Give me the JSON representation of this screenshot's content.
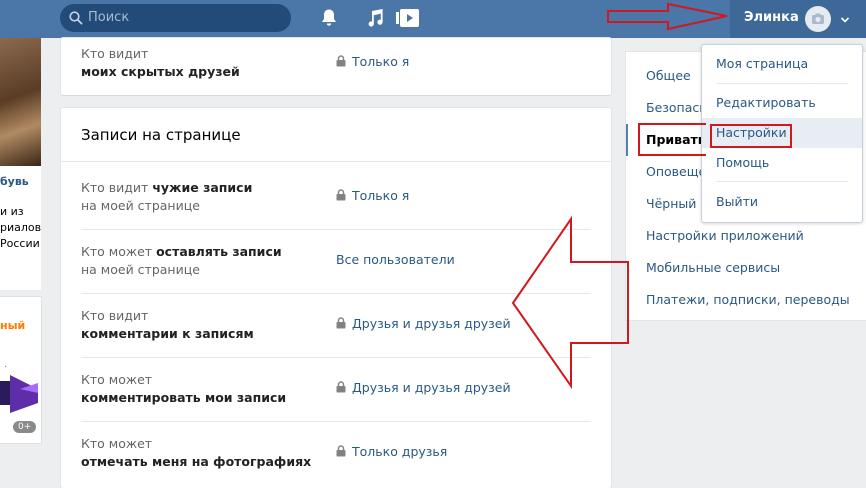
{
  "header": {
    "search_placeholder": "Поиск",
    "user_name": "Элинка"
  },
  "left": {
    "link_text": "бувь",
    "text_lines": [
      "и из",
      "риалов",
      "России"
    ],
    "ad_label": "ный",
    "ad_badge": "0+"
  },
  "card1": {
    "row": {
      "label_plain": "Кто видит",
      "label_bold": "моих скрытых друзей",
      "value": "Только я",
      "locked": true
    }
  },
  "card2": {
    "title": "Записи на странице",
    "rows": [
      {
        "label_plain": "Кто видит",
        "label_bold": "чужие записи",
        "label_plain2": "на моей странице",
        "value": "Только я",
        "locked": true
      },
      {
        "label_plain": "Кто может",
        "label_bold": "оставлять записи",
        "label_plain2": "на моей странице",
        "value": "Все пользователи",
        "locked": false
      },
      {
        "label_plain": "Кто видит",
        "label_bold": "комментарии к записям",
        "value": "Друзья и друзья друзей",
        "locked": true
      },
      {
        "label_plain": "Кто может",
        "label_bold": "комментировать мои записи",
        "value": "Друзья и друзья друзей",
        "locked": true
      },
      {
        "label_plain": "Кто может",
        "label_bold": "отмечать меня на фотографиях",
        "value": "Только друзья",
        "locked": true
      }
    ]
  },
  "nav": {
    "items": [
      "Общее",
      "Безопасность",
      "Приватность",
      "Оповещения",
      "Чёрный список",
      "Настройки приложений",
      "Мобильные сервисы",
      "Платежи, подписки, переводы"
    ],
    "active_index": 2
  },
  "dropdown": {
    "items": [
      "Моя страница",
      "Редактировать",
      "Настройки",
      "Помощь",
      "Выйти"
    ],
    "highlighted_index": 2
  },
  "colors": {
    "header_bg": "#4a76a8",
    "link": "#2a5885",
    "annotation_red": "#d0191f"
  }
}
